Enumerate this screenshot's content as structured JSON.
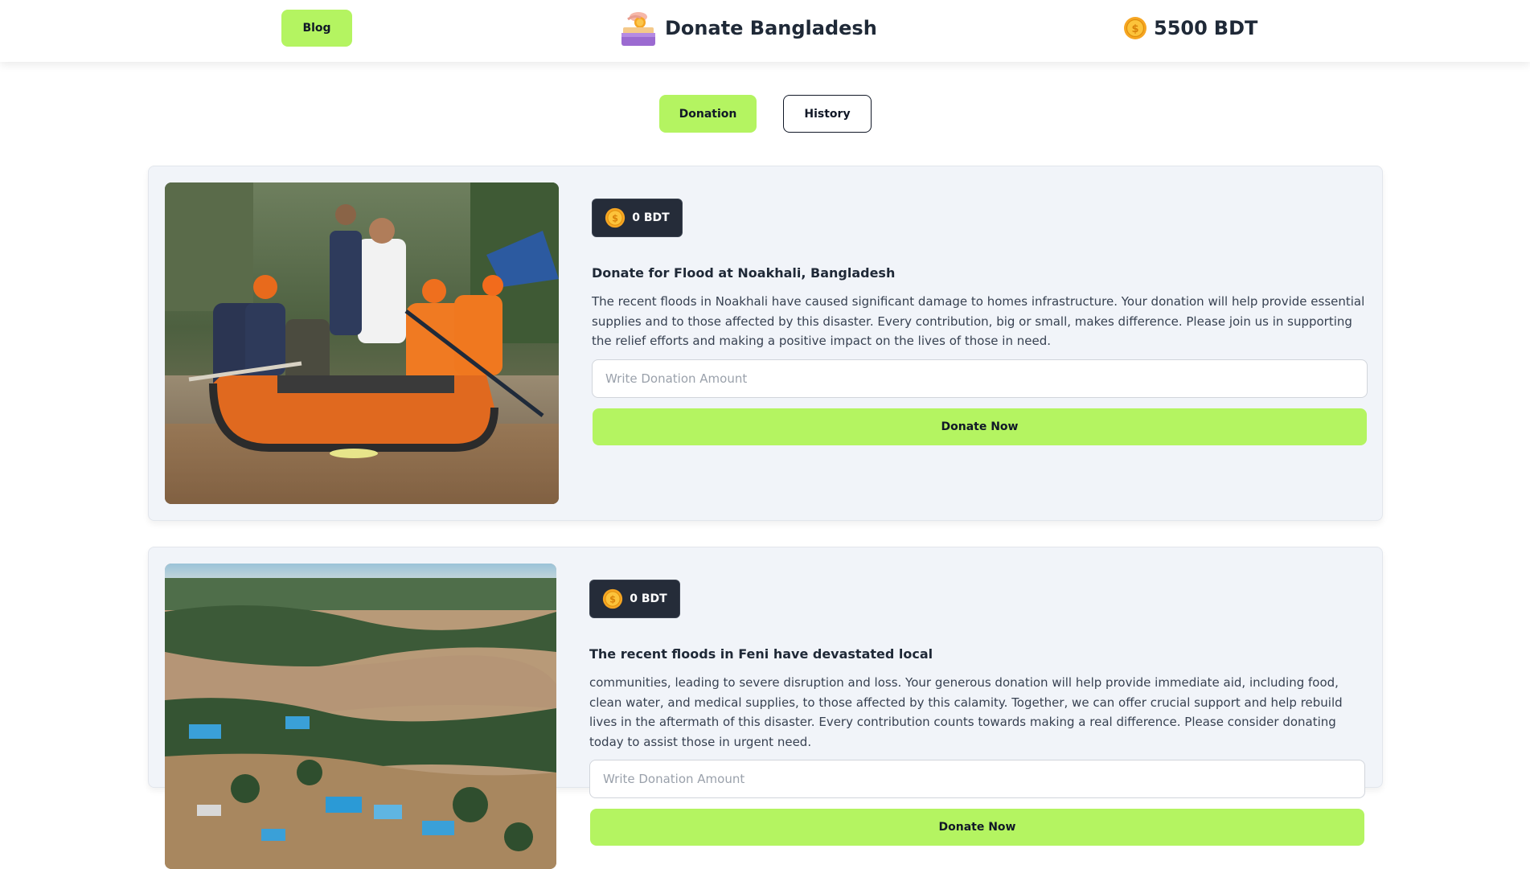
{
  "header": {
    "blog_label": "Blog",
    "brand_title": "Donate Bangladesh",
    "brand_logo_icon": "donation-box-logo-icon",
    "balance_amount": "5500",
    "balance_currency": "BDT",
    "coin_icon": "gold-coin-icon"
  },
  "tabs": {
    "donation_label": "Donation",
    "history_label": "History"
  },
  "colors": {
    "accent_lime": "#b4f461",
    "card_bg": "#f1f4f9",
    "badge_dark": "#252c39",
    "text_dark": "#1f2937"
  },
  "cards": [
    {
      "badge_amount": "0 BDT",
      "title": "Donate for Flood at Noakhali, Bangladesh",
      "description": "The recent floods in Noakhali have caused significant damage to homes infrastructure. Your donation will help provide essential supplies and to those affected by this disaster. Every contribution, big or small, makes difference. Please join us in supporting the relief efforts and making a positive impact on the lives of those in need.",
      "input_placeholder": "Write Donation Amount",
      "input_value": "",
      "button_label": "Donate Now",
      "image_subject": "rescue team on inflatable boat in flood water"
    },
    {
      "badge_amount": "0 BDT",
      "title": "The recent floods in Feni have devastated local",
      "description": "communities, leading to severe disruption and loss. Your generous donation will help provide immediate aid, including food, clean water, and medical supplies, to those affected by this calamity. Together, we can offer crucial support and help rebuild lives in the aftermath of this disaster. Every contribution counts towards making a real difference. Please consider donating today to assist those in urgent need.",
      "input_placeholder": "Write Donation Amount",
      "input_value": "",
      "button_label": "Donate Now",
      "image_subject": "aerial view of flooded town"
    }
  ]
}
